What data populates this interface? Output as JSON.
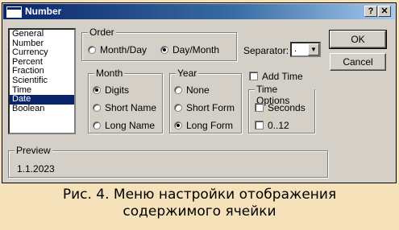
{
  "window": {
    "title": "Number",
    "help_label": "?",
    "close_label": "x"
  },
  "category_list": {
    "items": [
      "General",
      "Number",
      "Currency",
      "Percent",
      "Fraction",
      "Scientific",
      "Time",
      "Date",
      "Boolean"
    ],
    "selected": "Date"
  },
  "order": {
    "label": "Order",
    "options": [
      "Month/Day",
      "Day/Month"
    ],
    "selected": "Day/Month"
  },
  "separator": {
    "label": "Separator:",
    "value": "."
  },
  "month": {
    "label": "Month",
    "options": [
      "Digits",
      "Short Name",
      "Long Name"
    ],
    "selected": "Digits"
  },
  "year": {
    "label": "Year",
    "options": [
      "None",
      "Short Form",
      "Long Form"
    ],
    "selected": "Long Form"
  },
  "add_time": {
    "label": "Add Time",
    "checked": false
  },
  "time_options": {
    "label": "Time Options",
    "seconds": {
      "label": "Seconds",
      "checked": false
    },
    "zero_twelve": {
      "label": "0..12",
      "checked": false
    }
  },
  "buttons": {
    "ok": "OK",
    "cancel": "Cancel"
  },
  "preview": {
    "label": "Preview",
    "value": "1.1.2023"
  },
  "caption": {
    "line1": "Рис. 4. Меню настройки отображения",
    "line2": "содержимого ячейки"
  }
}
